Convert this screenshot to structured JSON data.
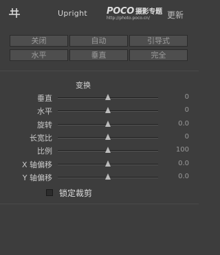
{
  "header": {
    "title": "Upright",
    "watermark_brand": "POCO",
    "watermark_brand_cn": "摄影专题",
    "watermark_url": "http://photo.poco.cn/",
    "update_label": "更新",
    "icon": "upright-icon"
  },
  "mode_buttons": {
    "row1": [
      {
        "label": "关闭",
        "active": false
      },
      {
        "label": "自动",
        "active": false
      },
      {
        "label": "引导式",
        "active": false
      }
    ],
    "row2": [
      {
        "label": "水平",
        "active": false
      },
      {
        "label": "垂直",
        "active": false
      },
      {
        "label": "完全",
        "active": false
      }
    ]
  },
  "transform": {
    "title": "变换",
    "sliders": [
      {
        "label": "垂直",
        "value": "0",
        "level": 0.5
      },
      {
        "label": "水平",
        "value": "0",
        "level": 0.5
      },
      {
        "label": "旋转",
        "value": "0.0",
        "level": 0.5
      },
      {
        "label": "长宽比",
        "value": "0",
        "level": 0.5
      },
      {
        "label": "比例",
        "value": "100",
        "level": 0.5
      },
      {
        "label": "X 轴偏移",
        "value": "0.0",
        "level": 0.5
      },
      {
        "label": "Y 轴偏移",
        "value": "0.0",
        "level": 0.5
      }
    ]
  },
  "constrain_crop": {
    "label": "锁定裁剪",
    "checked": false
  },
  "colors": {
    "panel_bg": "#3d3d3d",
    "button_bg": "#4e4e4e",
    "thumb": "#bcbcbc"
  }
}
